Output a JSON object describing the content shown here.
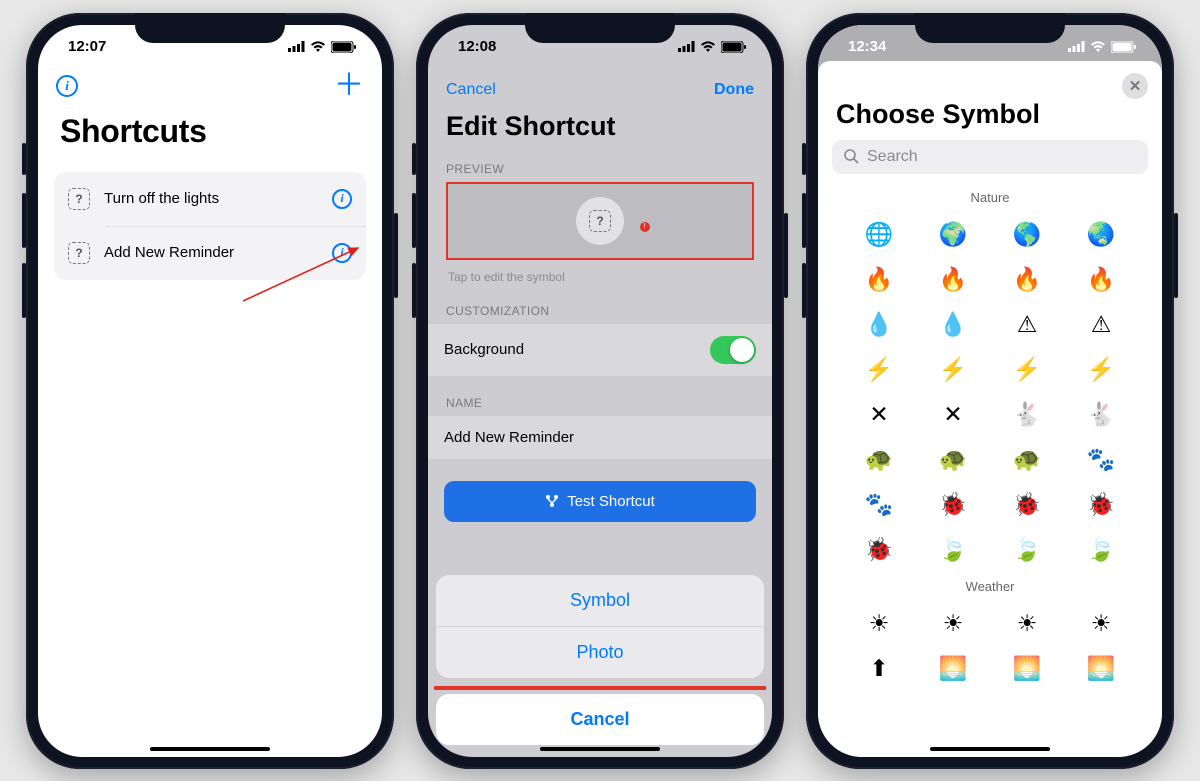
{
  "phone1": {
    "time": "12:07",
    "title": "Shortcuts",
    "rows": [
      {
        "label": "Turn off the lights"
      },
      {
        "label": "Add New Reminder"
      }
    ]
  },
  "phone2": {
    "time": "12:08",
    "nav": {
      "cancel": "Cancel",
      "done": "Done"
    },
    "title": "Edit Shortcut",
    "section_preview": "PREVIEW",
    "preview_hint": "Tap to edit the symbol",
    "section_custom": "CUSTOMIZATION",
    "bg_label": "Background",
    "section_name": "NAME",
    "name_value": "Add New Reminder",
    "test_label": "Test Shortcut",
    "sheet": {
      "symbol": "Symbol",
      "photo": "Photo",
      "cancel": "Cancel"
    }
  },
  "phone3": {
    "time": "12:34",
    "title": "Choose Symbol",
    "search_placeholder": "Search",
    "cat1": "Nature",
    "cat2": "Weather",
    "nature_glyphs": [
      "🌐",
      "🌍",
      "🌎",
      "🌏",
      "🔥",
      "🔥",
      "🔥",
      "🔥",
      "💧",
      "💧",
      "⚠",
      "⚠",
      "⚡",
      "⚡",
      "⚡",
      "⚡",
      "✕",
      "✕",
      "🐇",
      "🐇",
      "🐢",
      "🐢",
      "🐢",
      "🐾",
      "🐾",
      "🐞",
      "🐞",
      "🐞",
      "🐞",
      "🍃",
      "🍃",
      "🍃"
    ],
    "weather_glyphs": [
      "☀",
      "☀",
      "☀",
      "☀",
      "⬆",
      "🌅",
      "🌅",
      "🌅"
    ]
  }
}
